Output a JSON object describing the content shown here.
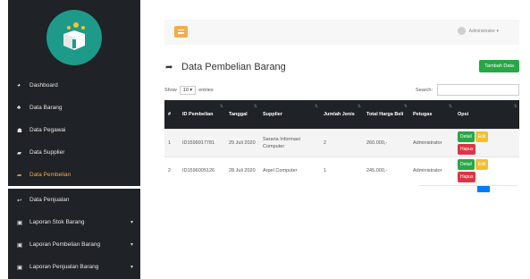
{
  "sidebar": {
    "items": [
      {
        "label": "Dashboard",
        "icon": "dashboard-icon",
        "glyph": "◕"
      },
      {
        "label": "Data Barang",
        "icon": "boxes-icon",
        "glyph": "♣"
      },
      {
        "label": "Data Pegawai",
        "icon": "users-icon",
        "glyph": "☗"
      },
      {
        "label": "Data Supplier",
        "icon": "truck-icon",
        "glyph": "▰"
      },
      {
        "label": "Data Pembelian",
        "icon": "share-icon",
        "glyph": "➦"
      },
      {
        "label": "Data Penjualan",
        "icon": "reply-icon",
        "glyph": "↩"
      },
      {
        "label": "Laporan Stok Barang",
        "icon": "report-icon",
        "glyph": "▣"
      },
      {
        "label": "Laporan Pembelian Barang",
        "icon": "report-icon",
        "glyph": "▣"
      },
      {
        "label": "Laporan Penjualan Barang",
        "icon": "report-icon",
        "glyph": "▣"
      }
    ],
    "active_color": "#f0ad4e"
  },
  "topbar": {
    "user_label": "Administrator ▾"
  },
  "page": {
    "title": "Data Pembelian Barang",
    "add_button": "Tambah Data"
  },
  "controls": {
    "show_label": "Show",
    "entries_value": "10",
    "entries_label": "entries",
    "search_label": "Search:"
  },
  "table": {
    "headers": [
      "#",
      "ID Pembelian",
      "Tanggal",
      "Supplier",
      "Jumlah Jenis",
      "Total Harga Beli",
      "Petugas",
      "Opsi"
    ],
    "rows": [
      {
        "no": "1",
        "id": "ID1599917781",
        "tanggal": "29 Juli 2020",
        "supplier": "Sarana Informasi Computer",
        "jumlah": "2",
        "total": "260.000,-",
        "petugas": "Administrator"
      },
      {
        "no": "2",
        "id": "ID1596005126",
        "tanggal": "28 Juli 2020",
        "supplier": "Arpel Computer",
        "jumlah": "1",
        "total": "245.000,-",
        "petugas": "Administrator"
      }
    ],
    "actions": {
      "detail": "Detail",
      "edit": "Edit",
      "hapus": "Hapus"
    }
  },
  "colors": {
    "sidebar_bg": "#1f2226",
    "accent_orange": "#f0ad4e",
    "success_green": "#28a745",
    "danger_red": "#dc3545",
    "logo_teal": "#1e9a8a"
  }
}
